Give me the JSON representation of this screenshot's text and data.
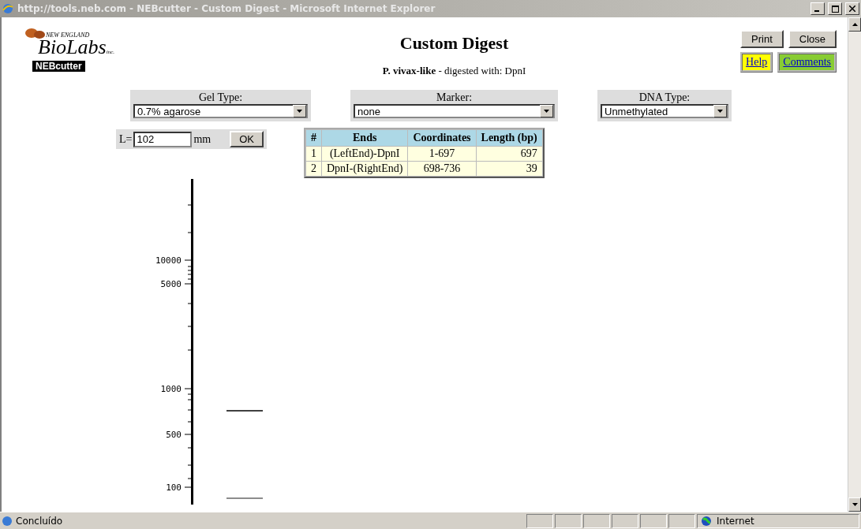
{
  "window": {
    "title": "http://tools.neb.com - NEBcutter - Custom Digest - Microsoft Internet Explorer"
  },
  "logo": {
    "tagline": "NEW ENGLAND",
    "name": "BioLabs",
    "suffix": "inc.",
    "badge": "NEBcutter"
  },
  "header": {
    "title": "Custom Digest",
    "subtitle": "**P. vivax-like** - digested with: DpnI"
  },
  "buttons": [
    "Print",
    "Close"
  ],
  "links": [
    {
      "label": "Help",
      "kind": "help"
    },
    {
      "label": "Comments",
      "kind": "comments"
    }
  ],
  "selects": [
    {
      "label": "Gel Type:",
      "value": "0.7% agarose",
      "kind": "wide"
    },
    {
      "label": "Marker:",
      "value": "none",
      "kind": "wider"
    },
    {
      "label": "DNA Type:",
      "value": "Unmethylated",
      "kind": "narrow"
    }
  ],
  "length": {
    "prefix": "L=",
    "value": "102",
    "unit": "mm",
    "button": "OK"
  },
  "table": {
    "columns": [
      "#",
      "Ends",
      "Coordinates",
      "Length (bp)"
    ],
    "rows": [
      [
        "1",
        "(LeftEnd)-DpnI",
        "1-697",
        "697"
      ],
      [
        "2",
        "DpnI-(RightEnd)",
        "698-736",
        "39"
      ]
    ]
  },
  "gel": {
    "scale_labels": [
      "10000",
      "5000",
      "1000",
      "500",
      "100"
    ]
  },
  "status_bar": {
    "text": "Concluído",
    "zone": "Internet"
  }
}
